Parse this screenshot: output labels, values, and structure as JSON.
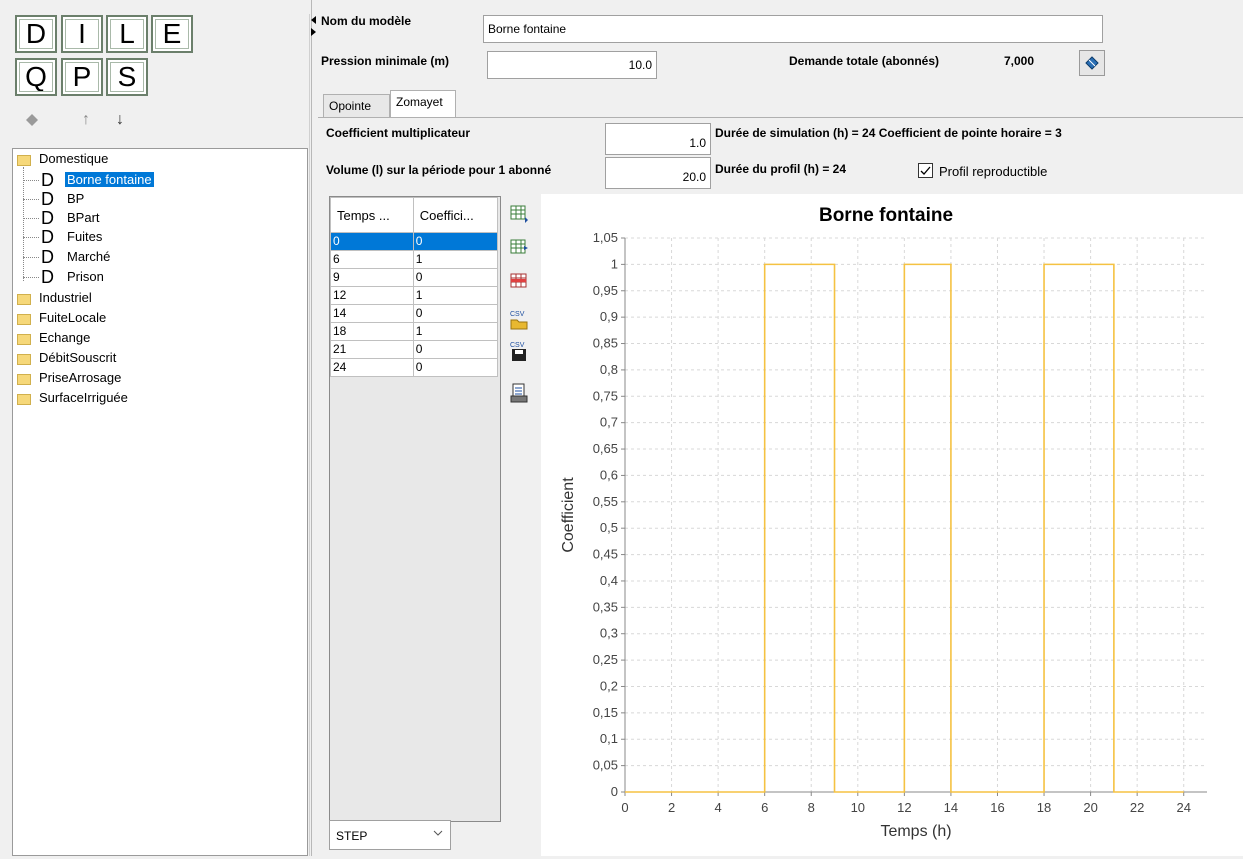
{
  "toolbar": {
    "letters_row1": [
      "D",
      "I",
      "L",
      "E"
    ],
    "letters_row2": [
      "Q",
      "P",
      "S"
    ],
    "up_arrow": "↑",
    "down_arrow": "↓"
  },
  "tree": {
    "groups": [
      {
        "label": "Domestique",
        "children": [
          {
            "prefix": "D",
            "label": "Borne fontaine",
            "selected": true
          },
          {
            "prefix": "D",
            "label": "BP"
          },
          {
            "prefix": "D",
            "label": "BPart"
          },
          {
            "prefix": "D",
            "label": "Fuites"
          },
          {
            "prefix": "D",
            "label": "Marché"
          },
          {
            "prefix": "D",
            "label": "Prison"
          }
        ]
      },
      {
        "label": "Industriel"
      },
      {
        "label": "FuiteLocale"
      },
      {
        "label": "Echange"
      },
      {
        "label": "DébitSouscrit"
      },
      {
        "label": "PriseArrosage"
      },
      {
        "label": "SurfaceIrriguée"
      }
    ]
  },
  "form": {
    "model_name_label": "Nom du modèle",
    "model_name_value": "Borne fontaine",
    "pressure_label": "Pression minimale (m)",
    "pressure_value": "10.0",
    "demand_label": "Demande totale (abonnés)",
    "demand_value": "7,000"
  },
  "tabs": [
    {
      "label": "Opointe",
      "active": false
    },
    {
      "label": "Zomayet",
      "active": true
    }
  ],
  "params": {
    "coef_label": "Coefficient multiplicateur",
    "coef_value": "1.0",
    "sim_label": "Durée de simulation (h) = 24 Coefficient de pointe horaire = 3",
    "volume_label": "Volume (l) sur la période pour 1 abonné",
    "volume_value": "20.0",
    "profile_label": "Durée du profil (h) = 24",
    "repro_label": "Profil reproductible",
    "repro_checked": true
  },
  "table": {
    "headers": [
      "Temps ...",
      "Coeffici..."
    ],
    "rows": [
      [
        "0",
        "0"
      ],
      [
        "6",
        "1"
      ],
      [
        "9",
        "0"
      ],
      [
        "12",
        "1"
      ],
      [
        "14",
        "0"
      ],
      [
        "18",
        "1"
      ],
      [
        "21",
        "0"
      ],
      [
        "24",
        "0"
      ]
    ],
    "selected_row": 0
  },
  "interp": {
    "selected": "STEP"
  },
  "icons": [
    "table-add-icon",
    "table-insert-icon",
    "table-delete-icon",
    "csv-import-icon",
    "csv-export-icon",
    "print-icon"
  ],
  "chart_data": {
    "type": "line",
    "step": true,
    "title": "Borne fontaine",
    "xlabel": "Temps (h)",
    "ylabel": "Coefficient",
    "xlim": [
      0,
      25
    ],
    "ylim": [
      0,
      1.05
    ],
    "xticks": [
      0,
      2,
      4,
      6,
      8,
      10,
      12,
      14,
      16,
      18,
      20,
      22,
      24
    ],
    "yticks": [
      "0",
      "0,05",
      "0,1",
      "0,15",
      "0,2",
      "0,25",
      "0,3",
      "0,35",
      "0,4",
      "0,45",
      "0,5",
      "0,55",
      "0,6",
      "0,65",
      "0,7",
      "0,75",
      "0,8",
      "0,85",
      "0,9",
      "0,95",
      "1",
      "1,05"
    ],
    "x": [
      0,
      6,
      9,
      12,
      14,
      18,
      21,
      24
    ],
    "y": [
      0,
      1,
      0,
      1,
      0,
      1,
      0,
      0
    ],
    "line_color": "#f5c242",
    "grid": true
  }
}
